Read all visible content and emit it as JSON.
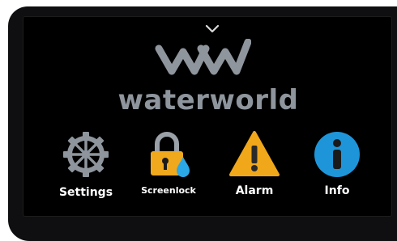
{
  "brand": {
    "name": "waterworld"
  },
  "apps": [
    {
      "label": "Settings",
      "icon": "gear-icon"
    },
    {
      "label": "Screenlock",
      "icon": "padlock-water-drop-icon"
    },
    {
      "label": "Alarm",
      "icon": "warning-triangle-icon"
    },
    {
      "label": "Info",
      "icon": "info-icon"
    }
  ],
  "colors": {
    "brand_gray": "#8e959c",
    "lock_gold": "#f0a81c",
    "drop_blue": "#2aa8e8",
    "alarm_amber": "#f1a71a",
    "info_blue": "#1e95d9"
  }
}
